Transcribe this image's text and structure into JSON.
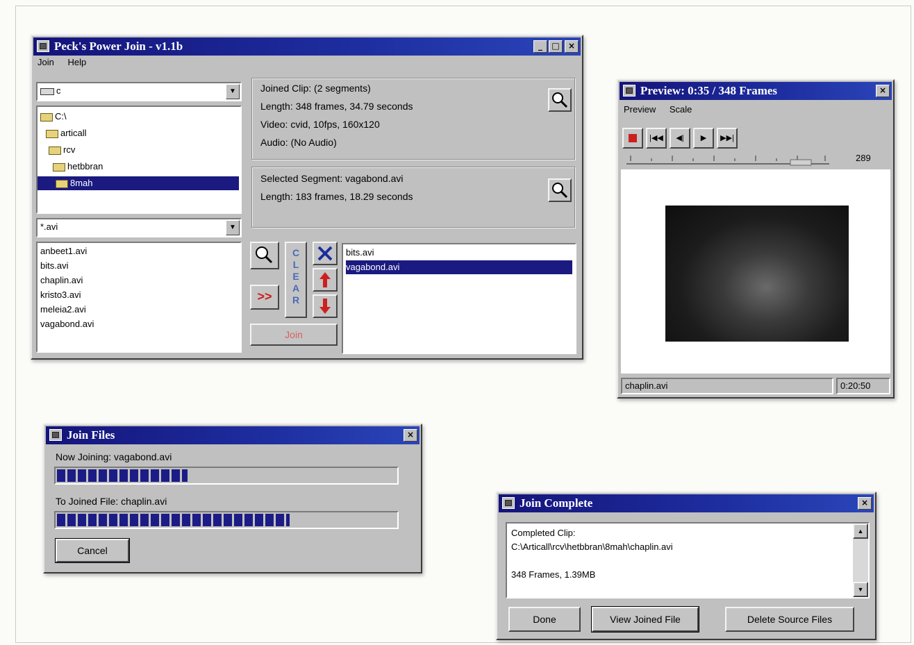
{
  "colors": {
    "titlebar": "#1a2a9a",
    "selection": "#1a1a80",
    "progress": "#1c1c86",
    "face": "#c0c0c0",
    "accent_red": "#cc2020"
  },
  "main": {
    "title": "Peck's Power Join - v1.1b",
    "menu": [
      "Join",
      "Help"
    ],
    "drive": "c",
    "folders": [
      "C:\\",
      "articall",
      "rcv",
      "hetbbran",
      "8mah"
    ],
    "folder_selected_index": 4,
    "filter": "*.avi",
    "files": [
      "anbeet1.avi",
      "bits.avi",
      "chaplin.avi",
      "kristo3.avi",
      "meleia2.avi",
      "vagabond.avi"
    ],
    "joined": {
      "header": "Joined Clip: (2 segments)",
      "length": "Length: 348 frames, 34.79 seconds",
      "video": "Video: cvid, 10fps, 160x120",
      "audio": "Audio: (No Audio)"
    },
    "segment": {
      "header": "Selected Segment: vagabond.avi",
      "length": "Length: 183 frames, 18.29 seconds"
    },
    "clear_label": "CLEAR",
    "add_label": ">>",
    "join_label": "Join",
    "segments": [
      "bits.avi",
      "vagabond.avi"
    ],
    "segment_selected_index": 1,
    "icons": [
      "magnifier-icon",
      "delete-icon",
      "move-up-icon",
      "move-down-icon",
      "add-icon"
    ]
  },
  "preview": {
    "title": "Preview: 0:35 / 348 Frames",
    "menu": [
      "Preview",
      "Scale"
    ],
    "slider_end": "289",
    "status_file": "chaplin.avi",
    "status_time": "0:20:50",
    "icons": [
      "stop-icon",
      "step-back-icon",
      "rewind-icon",
      "play-icon",
      "step-forward-icon"
    ]
  },
  "joinfiles": {
    "title": "Join Files",
    "now_joining": "Now Joining: vagabond.avi",
    "now_progress": 0.39,
    "to_file": "To Joined File: chaplin.avi",
    "to_progress": 0.69,
    "cancel": "Cancel"
  },
  "complete": {
    "title": "Join Complete",
    "lines": [
      "Completed Clip:",
      "C:\\Articall\\rcv\\hetbbran\\8mah\\chaplin.avi",
      "",
      "348 Frames, 1.39MB"
    ],
    "done": "Done",
    "view": "View Joined File",
    "delete": "Delete Source Files"
  }
}
